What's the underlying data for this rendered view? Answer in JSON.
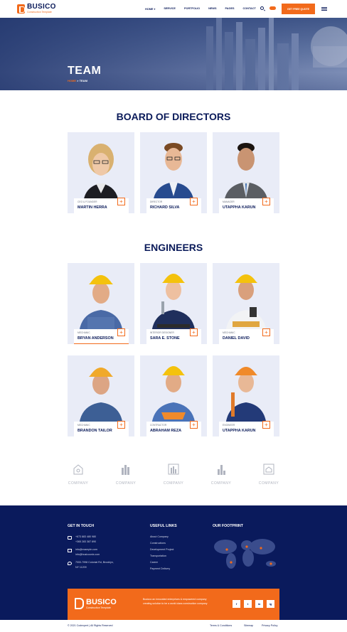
{
  "brand": {
    "name": "BUSICO",
    "tagline": "Construction Template"
  },
  "nav": {
    "items": [
      "HOME ▾",
      "SERVICE",
      "PORTFOLIO",
      "NEWS",
      "PAGES",
      "CONTACT"
    ],
    "quote_button": "GET FREE QUOTE",
    "accent": "#f26a1b",
    "navy": "#0b1b5a"
  },
  "hero": {
    "title": "TEAM",
    "crumb_home": "HOME",
    "crumb_sep": " > ",
    "crumb_current": "TEAM"
  },
  "directors": {
    "title": "BOARD OF DIRECTORS",
    "members": [
      {
        "role": "CEO & FOUNDER",
        "name": "MARTIN HERRA"
      },
      {
        "role": "DIRECTOR",
        "name": "RICHARD SILVA"
      },
      {
        "role": "MANAGER",
        "name": "UTAPPHA KARUN"
      }
    ]
  },
  "engineers": {
    "title": "ENGINEERS",
    "members": [
      {
        "role": "MECHANIC",
        "name": "BRYAN ANDERSON"
      },
      {
        "role": "INTERIOR DESIGNER",
        "name": "SARA E. STONE"
      },
      {
        "role": "MECHANIC",
        "name": "DANIEL DAVID"
      },
      {
        "role": "MECHANIC",
        "name": "BRANDON TAILOR"
      },
      {
        "role": "CONTRACTOR",
        "name": "ABRAHAM REZA"
      },
      {
        "role": "ENGINEER",
        "name": "UTAPPHA KARUN"
      }
    ]
  },
  "plus_symbol": "+",
  "partners": {
    "label": "COMPANY"
  },
  "footer": {
    "touch_title": "GET IN TOUCH",
    "phone1": "+673 883 480 980",
    "phone2": "+365 283 387 890",
    "email1": "info@example.com",
    "email2": "info@busicoonix.com",
    "address1": "7000-7998 Colonial Rd, Brooklyn,",
    "address2": "NY 11209",
    "links_title": "USEFUL LINKS",
    "links": [
      "About Company",
      "Constructions",
      "Development Project",
      "Transportation",
      "Career",
      "Payment Delivery"
    ],
    "footprint_title": "OUR FOOTPRINT",
    "cta_text": "Busicoo an innovated enterprises & empowered company creating solution to be a world class construction company",
    "social": [
      "f",
      "t",
      "in",
      "ig"
    ],
    "copyright": "© 2021 Codexpert | All Rights Reserved",
    "bottom_links": [
      "Terms & Conditions",
      "Sitemap",
      "Privacy Policy"
    ]
  }
}
